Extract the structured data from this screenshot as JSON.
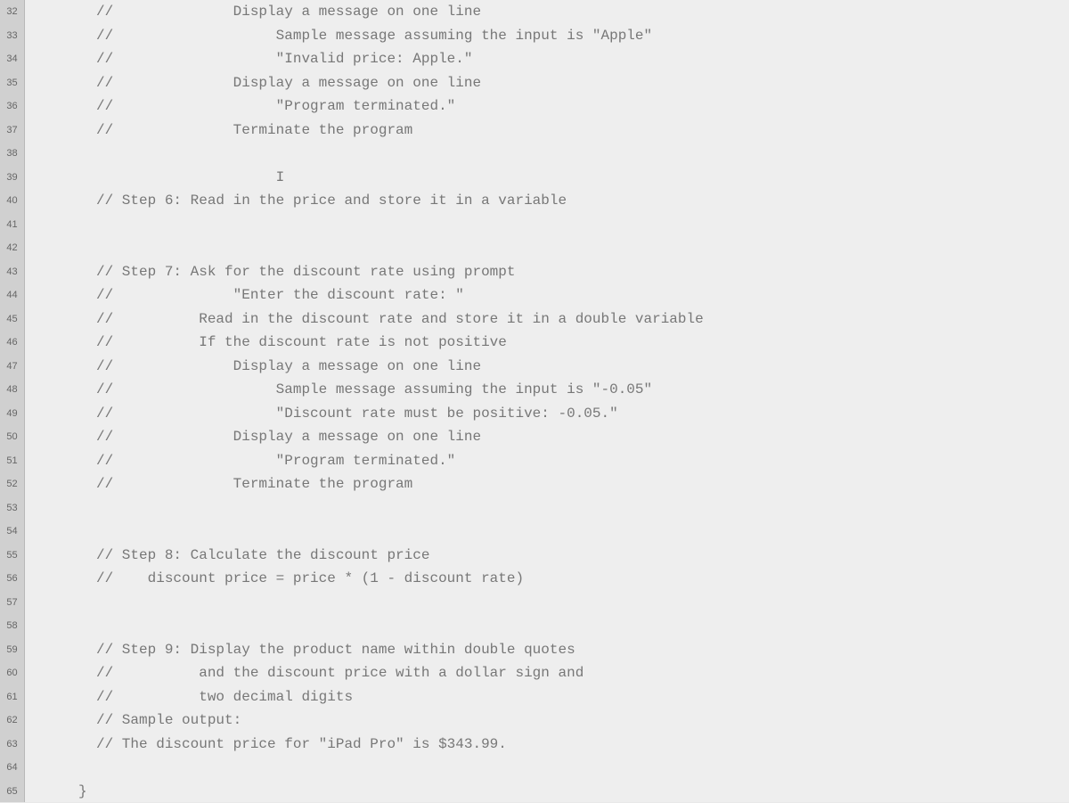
{
  "first_line_number": 32,
  "last_line_number": 65,
  "lines": {
    "32": "//              Display a message on one line",
    "33": "//                   Sample message assuming the input is \"Apple\"",
    "34": "//                   \"Invalid price: Apple.\"",
    "35": "//              Display a message on one line",
    "36": "//                   \"Program terminated.\"",
    "37": "//              Terminate the program",
    "38": "",
    "39": "                     I",
    "40": "// Step 6: Read in the price and store it in a variable",
    "41": "",
    "42": "",
    "43": "// Step 7: Ask for the discount rate using prompt",
    "44": "//              \"Enter the discount rate: \"",
    "45": "//          Read in the discount rate and store it in a double variable",
    "46": "//          If the discount rate is not positive",
    "47": "//              Display a message on one line",
    "48": "//                   Sample message assuming the input is \"-0.05\"",
    "49": "//                   \"Discount rate must be positive: -0.05.\"",
    "50": "//              Display a message on one line",
    "51": "//                   \"Program terminated.\"",
    "52": "//              Terminate the program",
    "53": "",
    "54": "",
    "55": "// Step 8: Calculate the discount price",
    "56": "//    discount price = price * (1 - discount rate)",
    "57": "",
    "58": "",
    "59": "// Step 9: Display the product name within double quotes",
    "60": "//          and the discount price with a dollar sign and",
    "61": "//          two decimal digits",
    "62": "// Sample output:",
    "63": "// The discount price for \"iPad Pro\" is $343.99.",
    "64": "",
    "65": "}"
  }
}
